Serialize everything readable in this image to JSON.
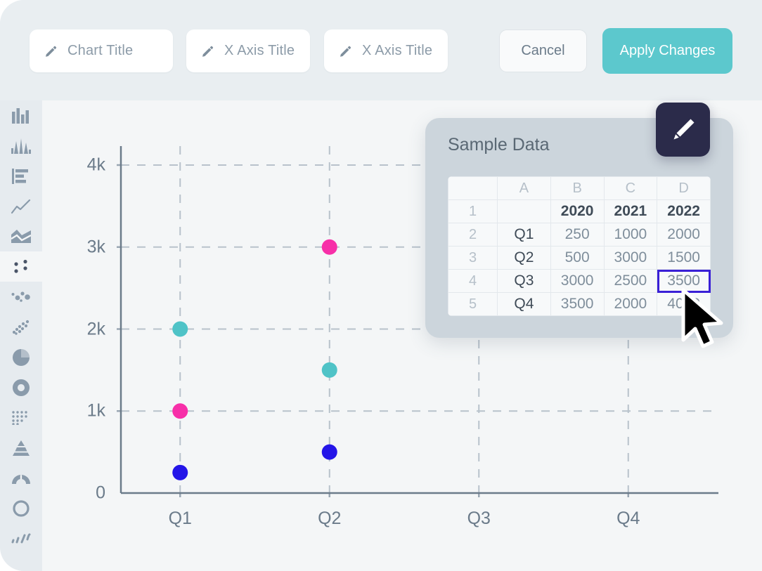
{
  "toolbar": {
    "chart_title_label": "Chart Title",
    "x_axis_title_label_1": "X Axis Title",
    "x_axis_title_label_2": "X Axis Title",
    "cancel_label": "Cancel",
    "apply_label": "Apply Changes"
  },
  "sidebar": {
    "items": [
      {
        "icon": "bar-chart-icon",
        "active": false
      },
      {
        "icon": "column-spike-icon",
        "active": false
      },
      {
        "icon": "horizontal-bar-icon",
        "active": false
      },
      {
        "icon": "line-chart-icon",
        "active": false
      },
      {
        "icon": "area-chart-icon",
        "active": false
      },
      {
        "icon": "scatter-plot-icon",
        "active": true
      },
      {
        "icon": "bubble-chart-icon",
        "active": false
      },
      {
        "icon": "dot-density-icon",
        "active": false
      },
      {
        "icon": "pie-chart-icon",
        "active": false
      },
      {
        "icon": "donut-chart-icon",
        "active": false
      },
      {
        "icon": "waffle-grid-icon",
        "active": false
      },
      {
        "icon": "pyramid-chart-icon",
        "active": false
      },
      {
        "icon": "gauge-chart-icon",
        "active": false
      },
      {
        "icon": "ring-chart-icon",
        "active": false
      },
      {
        "icon": "sparkline-icon",
        "active": false
      }
    ]
  },
  "data_panel": {
    "title": "Sample Data",
    "edit_badge_icon": "pencil-icon",
    "columns": [
      "",
      "A",
      "B",
      "C",
      "D"
    ],
    "rows": [
      {
        "num": "1",
        "cells": [
          "",
          "2020",
          "2021",
          "2022"
        ],
        "header": true
      },
      {
        "num": "2",
        "cells": [
          "Q1",
          "250",
          "1000",
          "2000"
        ]
      },
      {
        "num": "3",
        "cells": [
          "Q2",
          "500",
          "3000",
          "1500"
        ]
      },
      {
        "num": "4",
        "cells": [
          "Q3",
          "3000",
          "2500",
          "3500"
        ],
        "selected_col": 3
      },
      {
        "num": "5",
        "cells": [
          "Q4",
          "3500",
          "2000",
          "4000"
        ]
      }
    ],
    "selected_cell": "D4",
    "selected_cell_value": "3500"
  },
  "colors": {
    "accent_teal": "#5cc8cd",
    "series_2020": "#2415e8",
    "series_2021": "#f72fa8",
    "series_2022": "#4fc3c7",
    "selection_border": "#3a20d6",
    "badge_dark": "#2b2b4a",
    "panel_bg": "#ccd5dc",
    "canvas_bg": "#f4f6f7",
    "chrome_bg": "#e9eef1"
  },
  "chart_data": {
    "type": "scatter",
    "title": "",
    "xlabel": "",
    "ylabel": "",
    "categories": [
      "Q1",
      "Q2",
      "Q3",
      "Q4"
    ],
    "yticks": [
      "0",
      "1k",
      "2k",
      "3k",
      "4k"
    ],
    "ytick_values": [
      0,
      1000,
      2000,
      3000,
      4000
    ],
    "ylim": [
      0,
      4000
    ],
    "grid": true,
    "grid_style": "dashed",
    "legend": "none",
    "series": [
      {
        "name": "2020",
        "color": "#2415e8",
        "values": [
          250,
          500,
          3000,
          3500
        ],
        "visible_points": [
          true,
          true,
          false,
          false
        ]
      },
      {
        "name": "2021",
        "color": "#f72fa8",
        "values": [
          1000,
          3000,
          2500,
          2000
        ],
        "visible_points": [
          true,
          true,
          false,
          false
        ]
      },
      {
        "name": "2022",
        "color": "#4fc3c7",
        "values": [
          2000,
          1500,
          3500,
          4000
        ],
        "visible_points": [
          true,
          true,
          false,
          false
        ]
      }
    ]
  },
  "cursor": {
    "icon": "mouse-pointer-icon"
  }
}
